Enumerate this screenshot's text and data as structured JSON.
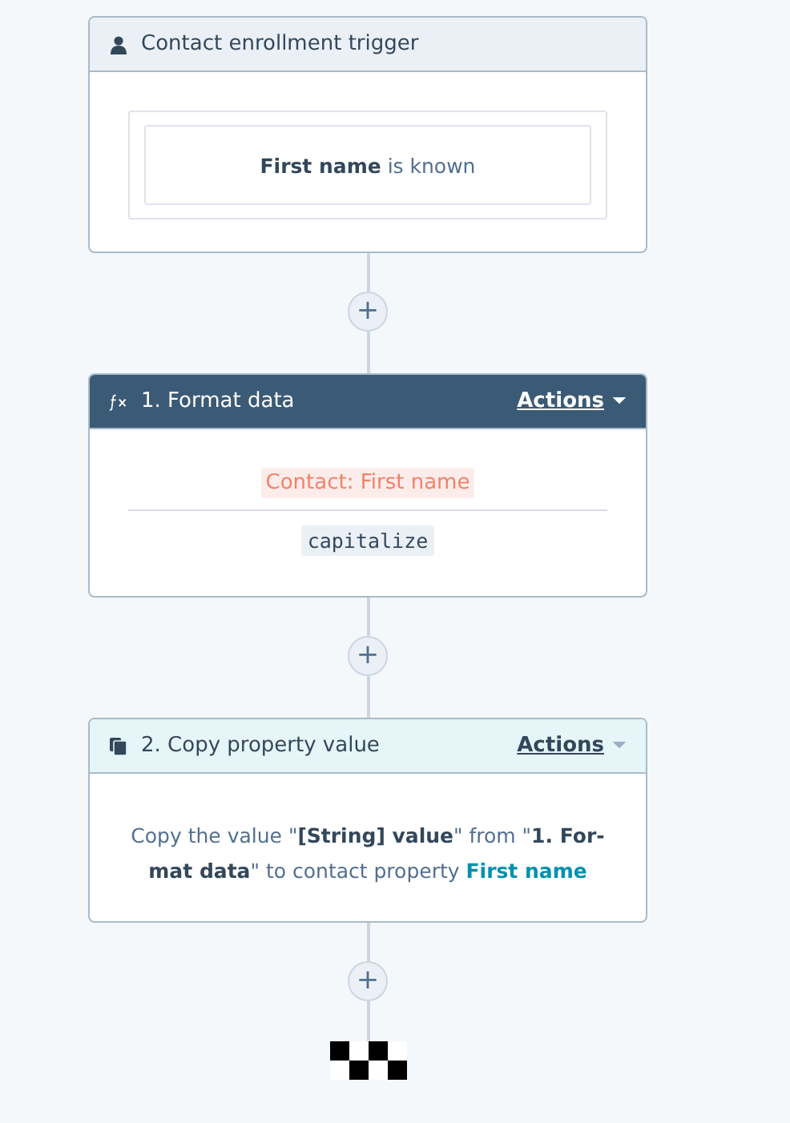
{
  "steps": [
    {
      "kind": "trigger",
      "title": "Contact enrollment trigger",
      "selected": false,
      "condition": "**First name** is known"
    },
    {
      "kind": "format",
      "title": "1. Format data",
      "selected": true,
      "actions": "Actions",
      "property": "Contact: First name",
      "function": "capitalize"
    },
    {
      "kind": "copy",
      "title": "2. Copy property value",
      "selected": false,
      "actions": "Actions",
      "sentence": "Copy the value \"**[String] value**\" from \"**1. For-mat data**\" to contact property",
      "link": "First name"
    }
  ],
  "add_buttons": [
    "+",
    "+",
    "+"
  ]
}
